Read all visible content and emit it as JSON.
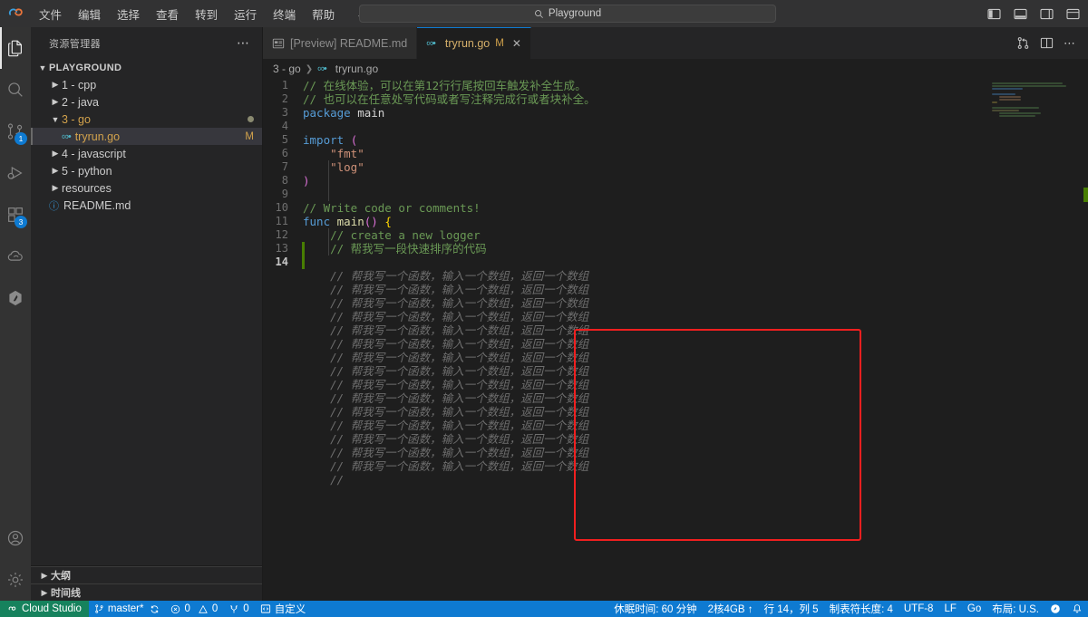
{
  "titlebar": {
    "logo_icon": "cloud-studio-logo-icon",
    "menus": [
      "文件",
      "编辑",
      "选择",
      "查看",
      "转到",
      "运行",
      "终端",
      "帮助"
    ],
    "nav_back_icon": "arrow-left-icon",
    "nav_forward_icon": "arrow-forward-icon",
    "search": {
      "value": "Playground",
      "icon": "search-icon"
    },
    "right_icons": [
      "toggle-primary-sidebar-icon",
      "toggle-panel-icon",
      "toggle-secondary-sidebar-icon",
      "customize-layout-icon"
    ]
  },
  "activitybar": {
    "items": [
      {
        "name": "explorer",
        "icon": "files-icon",
        "active": true,
        "badge": ""
      },
      {
        "name": "search",
        "icon": "search-icon",
        "active": false,
        "badge": ""
      },
      {
        "name": "source-control",
        "icon": "source-control-icon",
        "active": false,
        "badge": "1"
      },
      {
        "name": "run-and-debug",
        "icon": "run-debug-icon",
        "active": false,
        "badge": ""
      },
      {
        "name": "extensions",
        "icon": "extensions-icon",
        "active": false,
        "badge": "3"
      },
      {
        "name": "cloud",
        "icon": "cloud-icon",
        "active": false,
        "badge": ""
      },
      {
        "name": "ai-assistant",
        "icon": "ai-hexagon-icon",
        "active": false,
        "badge": ""
      }
    ],
    "bottom": [
      {
        "name": "account",
        "icon": "account-icon"
      },
      {
        "name": "settings",
        "icon": "gear-icon"
      }
    ]
  },
  "sidebar": {
    "title": "资源管理器",
    "more_icon": "ellipsis-icon",
    "root": {
      "label": "PLAYGROUND",
      "expanded": true
    },
    "tree": [
      {
        "label": "1 - cpp",
        "type": "folder",
        "expanded": false,
        "indent": 1,
        "selected": false,
        "badge": "",
        "modified": false
      },
      {
        "label": "2 - java",
        "type": "folder",
        "expanded": false,
        "indent": 1,
        "selected": false,
        "badge": "",
        "modified": false
      },
      {
        "label": "3 - go",
        "type": "folder",
        "expanded": true,
        "indent": 1,
        "selected": false,
        "badge": "dot",
        "modified": true
      },
      {
        "label": "tryrun.go",
        "type": "go",
        "expanded": false,
        "indent": 2,
        "selected": true,
        "badge": "M",
        "modified": true
      },
      {
        "label": "4 - javascript",
        "type": "folder",
        "expanded": false,
        "indent": 1,
        "selected": false,
        "badge": "",
        "modified": false
      },
      {
        "label": "5 - python",
        "type": "folder",
        "expanded": false,
        "indent": 1,
        "selected": false,
        "badge": "",
        "modified": false
      },
      {
        "label": "resources",
        "type": "folder",
        "expanded": false,
        "indent": 1,
        "selected": false,
        "badge": "",
        "modified": false
      },
      {
        "label": "README.md",
        "type": "md",
        "expanded": false,
        "indent": 1,
        "selected": false,
        "badge": "",
        "modified": false
      }
    ],
    "panels": [
      {
        "label": "大纲",
        "expanded": false
      },
      {
        "label": "时间线",
        "expanded": false
      }
    ]
  },
  "editor": {
    "tabs": [
      {
        "label": "[Preview] README.md",
        "icon": "preview-markdown-icon",
        "active": false,
        "dirty_badge": "",
        "closable": false
      },
      {
        "label": "tryrun.go",
        "icon": "go-icon",
        "active": true,
        "dirty_badge": "M",
        "closable": true
      }
    ],
    "tab_actions": [
      "compare-changes-icon",
      "split-editor-icon",
      "more-actions-icon"
    ],
    "breadcrumb": {
      "folder": "3 - go",
      "separator": ">",
      "file": "tryrun.go",
      "file_icon": "go-icon"
    },
    "lines": [
      {
        "n": 1,
        "tokens": [
          {
            "t": "cmt",
            "v": "// 在线体验，可以在第12行行尾按回车触发补全生成。"
          }
        ]
      },
      {
        "n": 2,
        "tokens": [
          {
            "t": "cmt",
            "v": "// 也可以在任意处写代码或者写注释完成行或者块补全。"
          }
        ]
      },
      {
        "n": 3,
        "tokens": [
          {
            "t": "kw",
            "v": "package "
          },
          {
            "t": "plain",
            "v": "main"
          }
        ]
      },
      {
        "n": 4,
        "tokens": []
      },
      {
        "n": 5,
        "tokens": [
          {
            "t": "kw",
            "v": "import "
          },
          {
            "t": "pn2",
            "v": "("
          }
        ]
      },
      {
        "n": 6,
        "tokens": [
          {
            "t": "str",
            "v": "    \"fmt\""
          }
        ]
      },
      {
        "n": 7,
        "tokens": [
          {
            "t": "str",
            "v": "    \"log\""
          }
        ]
      },
      {
        "n": 8,
        "tokens": [
          {
            "t": "pn2",
            "v": ")"
          }
        ]
      },
      {
        "n": 9,
        "tokens": []
      },
      {
        "n": 10,
        "tokens": [
          {
            "t": "cmt",
            "v": "// Write code or comments!"
          }
        ]
      },
      {
        "n": 11,
        "tokens": [
          {
            "t": "kw",
            "v": "func "
          },
          {
            "t": "fn",
            "v": "main"
          },
          {
            "t": "pn2",
            "v": "()"
          },
          {
            "t": "plain",
            "v": " "
          },
          {
            "t": "pn",
            "v": "{"
          }
        ]
      },
      {
        "n": 12,
        "tokens": [
          {
            "t": "cmt",
            "v": "    // create a new logger"
          }
        ]
      },
      {
        "n": 13,
        "tokens": [
          {
            "t": "cmt",
            "v": "    // 帮我写一段快速排序的代码"
          }
        ],
        "modified": true
      },
      {
        "n": 14,
        "tokens": [],
        "current": true,
        "modified": true
      }
    ],
    "suggestion": {
      "repeat_line": "// 帮我写一个函数，输入一个数组，返回一个数组",
      "repeat_count": 15,
      "last_line": "// ",
      "highlight_color": "#f01f1f"
    }
  },
  "statusbar": {
    "left": [
      {
        "name": "remote-host",
        "label": "Cloud Studio",
        "icon": "remote-icon"
      },
      {
        "name": "branch",
        "label": "master*",
        "icon": "git-branch-icon",
        "trailing_icon": "sync-icon"
      },
      {
        "name": "problems",
        "label": "0 0",
        "errors": "0",
        "warnings": "0",
        "error_icon": "error-icon",
        "warning_icon": "warning-icon"
      },
      {
        "name": "ports",
        "label": "0",
        "icon": "ports-icon"
      },
      {
        "name": "customize",
        "label": "自定义",
        "icon": "customize-icon"
      }
    ],
    "right": [
      {
        "name": "hibernate-time",
        "label": "休眠时间: 60 分钟"
      },
      {
        "name": "machine-spec",
        "label": "2核4GB ↑"
      },
      {
        "name": "cursor-position",
        "label": "行 14，列 5"
      },
      {
        "name": "indentation",
        "label": "制表符长度: 4"
      },
      {
        "name": "encoding",
        "label": "UTF-8"
      },
      {
        "name": "eol",
        "label": "LF"
      },
      {
        "name": "language-mode",
        "label": "Go"
      },
      {
        "name": "keyboard-layout",
        "label": "布局: U.S."
      },
      {
        "name": "feedback",
        "label": "",
        "icon": "feedback-icon"
      },
      {
        "name": "notifications",
        "label": "",
        "icon": "bell-icon"
      }
    ]
  },
  "colors": {
    "accent": "#0e7ad1",
    "remote_green": "#16825d",
    "modified_yellow": "#d2a24c",
    "comment_green": "#6a9955",
    "highlight_red": "#f01f1f",
    "gutter_green": "#487e02"
  }
}
